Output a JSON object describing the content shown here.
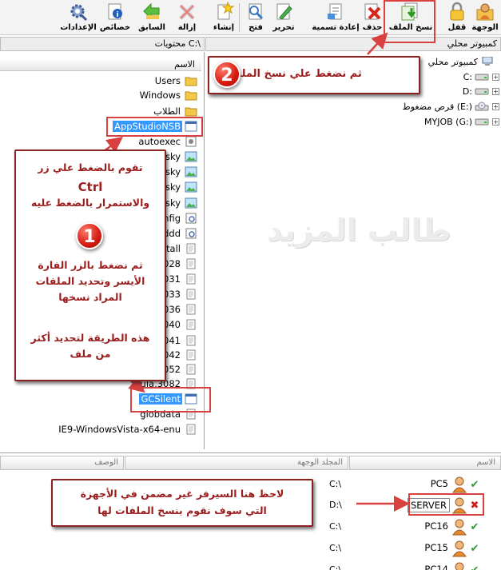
{
  "toolbar": {
    "buttons": [
      {
        "label": "الوجهة",
        "icon": "user-folder-icon"
      },
      {
        "label": "قفل",
        "icon": "lock-icon"
      },
      {
        "label": "نسخ الملف",
        "icon": "copy-file-icon"
      },
      {
        "label": "حذف",
        "icon": "delete-icon"
      },
      {
        "label": "إعادة تسمية",
        "icon": "rename-icon"
      },
      {
        "label": "تحرير",
        "icon": "edit-icon"
      },
      {
        "label": "فتح",
        "icon": "open-icon"
      },
      {
        "label": "إنشاء",
        "icon": "new-icon"
      },
      {
        "label": "إزالة",
        "icon": "remove-icon"
      },
      {
        "label": "السابق",
        "icon": "back-icon"
      },
      {
        "label": "خصائص",
        "icon": "properties-icon"
      },
      {
        "label": "الإعدادات",
        "icon": "settings-icon"
      }
    ]
  },
  "left_pane": {
    "header": "محتويات C:\\",
    "name_column": "الاسم",
    "rows": [
      {
        "name": "Users",
        "icon": "folder-icon"
      },
      {
        "name": "Windows",
        "icon": "folder-icon"
      },
      {
        "name": "الطلاب",
        "icon": "folder-icon"
      },
      {
        "name": "AppStudioNSB",
        "icon": "app-icon"
      },
      {
        "name": "autoexec",
        "icon": "batch-file-icon"
      },
      {
        "name": "sky",
        "icon": "image-file-icon"
      },
      {
        "name": "sky",
        "icon": "image-file-icon"
      },
      {
        "name": "sky",
        "icon": "image-file-icon"
      },
      {
        "name": "sky",
        "icon": "image-file-icon"
      },
      {
        "name": "nfig",
        "icon": "config-file-icon"
      },
      {
        "name": "dddd",
        "icon": "config-file-icon"
      },
      {
        "name": "stall",
        "icon": "text-file-icon"
      },
      {
        "name": "028",
        "icon": "text-file-icon"
      },
      {
        "name": "031",
        "icon": "text-file-icon"
      },
      {
        "name": "033",
        "icon": "text-file-icon"
      },
      {
        "name": "036",
        "icon": "text-file-icon"
      },
      {
        "name": "040",
        "icon": "text-file-icon"
      },
      {
        "name": "041",
        "icon": "text-file-icon"
      },
      {
        "name": "042",
        "icon": "text-file-icon"
      },
      {
        "name": "2052",
        "icon": "text-file-icon"
      },
      {
        "name": "ula.3082",
        "icon": "text-file-icon"
      },
      {
        "name": "GCSilent",
        "icon": "app-icon"
      },
      {
        "name": "globdata",
        "icon": "text-file-icon"
      },
      {
        "name": "IE9-WindowsVista-x64-enu",
        "icon": "text-file-icon"
      }
    ]
  },
  "right_pane": {
    "header": "كمبيوتر محلي",
    "tree": [
      {
        "label": "كمبيوتر محلي",
        "icon": "computer-icon"
      },
      {
        "label": "C:",
        "icon": "drive-icon"
      },
      {
        "label": "D:",
        "icon": "drive-icon"
      },
      {
        "label": "قرص مضغوط (E:)",
        "icon": "cd-drive-icon"
      },
      {
        "label": "MYJOB (G:)",
        "icon": "drive-icon"
      }
    ]
  },
  "destinations": {
    "columns": [
      "الاسم",
      "المجلد الوجهة",
      "الوصف"
    ],
    "rows": [
      {
        "name": "PC5",
        "dest": "C:\\",
        "status": "ok"
      },
      {
        "name": "SERVER",
        "dest": "D:\\",
        "status": "excluded"
      },
      {
        "name": "PC16",
        "dest": "C:\\",
        "status": "ok"
      },
      {
        "name": "PC15",
        "dest": "C:\\",
        "status": "ok"
      },
      {
        "name": "PC14",
        "dest": "C:\\",
        "status": "ok"
      }
    ]
  },
  "annotations": {
    "step1_badge": "1",
    "step2_badge": "2",
    "step1_line1": "تقوم بالضغط علي زر",
    "step1_key": "Ctrl",
    "step1_line2": "والاستمرار بالضغط عليه",
    "step1_line3": "ثم نضغط بالزر الفارة",
    "step1_line4": "الأيسر وتحديد الملفات",
    "step1_line5": "المراد نسخها",
    "step1_line6": "هذه الطريقة لتحديد أكثر",
    "step1_line7": "من ملف",
    "step2_text": "ثم نضغط علي نسخ الملف",
    "server_note_line1": "لاحظ هنا السيرفر غير مضمن في الأجهزة",
    "server_note_line2": "التي سوف نقوم بنسخ الملفات لها",
    "watermark": "طالب المزيد"
  },
  "colors": {
    "annotation_red": "#9b1d1d",
    "selection_blue": "#3399ff",
    "badge_red": "#d31b10"
  }
}
